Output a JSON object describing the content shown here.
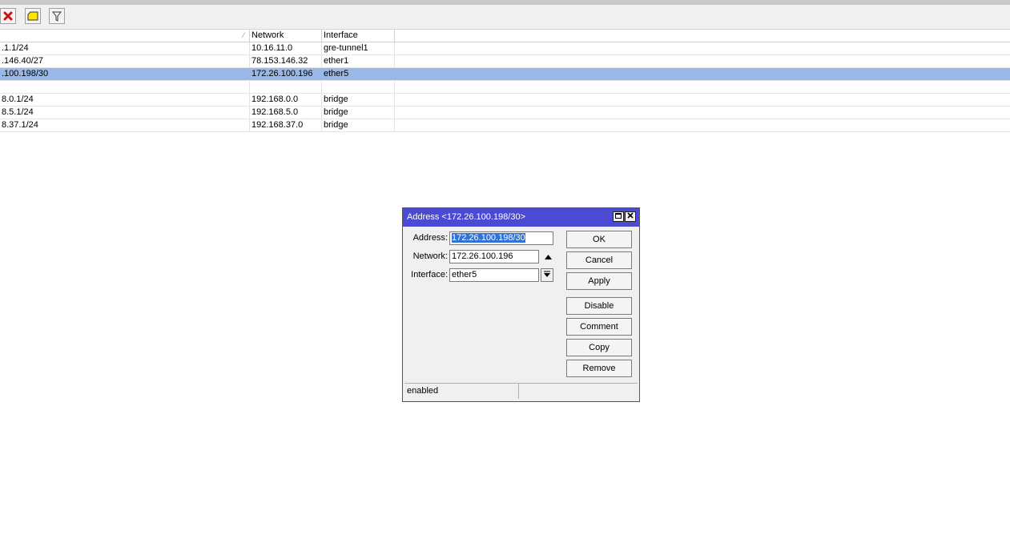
{
  "table": {
    "columns": [
      "",
      "Network",
      "Interface"
    ],
    "rows": [
      {
        "address": ".1.1/24",
        "network": "10.16.11.0",
        "interface": "gre-tunnel1",
        "selected": false
      },
      {
        "address": ".146.40/27",
        "network": "78.153.146.32",
        "interface": "ether1",
        "selected": false
      },
      {
        "address": ".100.198/30",
        "network": "172.26.100.196",
        "interface": "ether5",
        "selected": true
      },
      {
        "address": "",
        "network": "",
        "interface": "",
        "selected": false
      },
      {
        "address": "8.0.1/24",
        "network": "192.168.0.0",
        "interface": "bridge",
        "selected": false
      },
      {
        "address": "8.5.1/24",
        "network": "192.168.5.0",
        "interface": "bridge",
        "selected": false
      },
      {
        "address": "8.37.1/24",
        "network": "192.168.37.0",
        "interface": "bridge",
        "selected": false
      }
    ]
  },
  "toolbar": {
    "icons": [
      "remove-icon",
      "comment-icon",
      "filter-icon"
    ]
  },
  "dialog": {
    "title": "Address <172.26.100.198/30>",
    "address_label": "Address:",
    "address_value": "172.26.100.198/30",
    "network_label": "Network:",
    "network_value": "172.26.100.196",
    "interface_label": "Interface:",
    "interface_value": "ether5",
    "buttons": {
      "ok": "OK",
      "cancel": "Cancel",
      "apply": "Apply",
      "disable": "Disable",
      "comment": "Comment",
      "copy": "Copy",
      "remove": "Remove"
    },
    "status": "enabled"
  },
  "colors": {
    "selection": "#99b8e6",
    "titlebar": "#4b4ad3",
    "text_highlight": "#3072d6"
  }
}
